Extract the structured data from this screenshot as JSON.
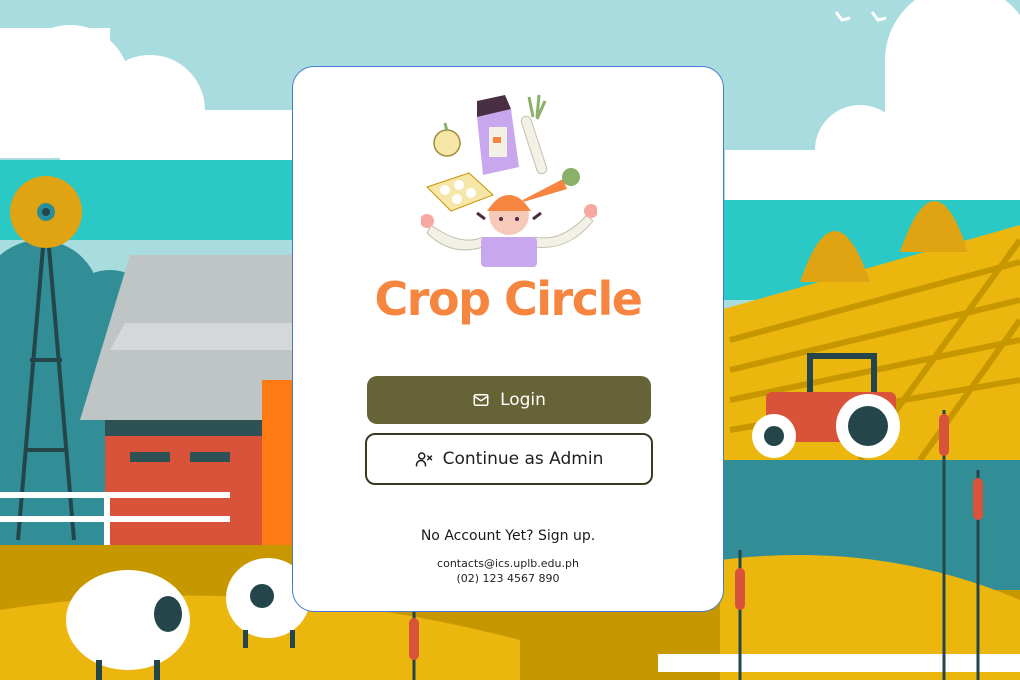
{
  "app": {
    "title": "Crop Circle"
  },
  "buttons": {
    "login_label": "Login",
    "admin_label": "Continue as Admin"
  },
  "signup": {
    "text": "No Account Yet? Sign up."
  },
  "contact": {
    "email": "contacts@ics.uplb.edu.ph",
    "phone": "(02) 123 4567 890"
  },
  "icons": {
    "login": "mail-icon",
    "admin": "user-x-icon",
    "logo": "farmer-groceries-illustration"
  },
  "colors": {
    "title": "#f5853f",
    "login_button": "#666437",
    "admin_border": "#3a3a22",
    "card_border": "#4a7bd0"
  }
}
